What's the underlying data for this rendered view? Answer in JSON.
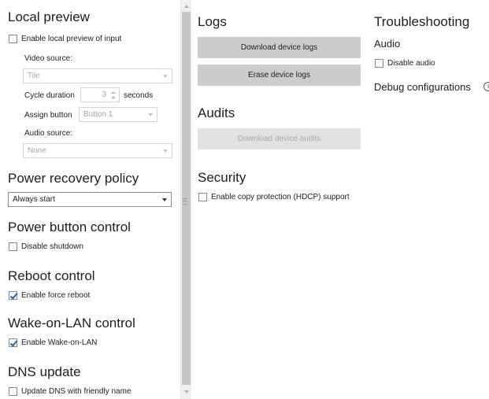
{
  "left": {
    "local_preview": {
      "title": "Local preview",
      "enable_label": "Enable local preview of input",
      "enable_checked": false,
      "video_source_label": "Video source:",
      "video_source_value": "Tile",
      "cycle_duration_label": "Cycle duration",
      "cycle_duration_value": "3",
      "cycle_duration_unit": "seconds",
      "assign_button_label": "Assign button",
      "assign_button_value": "Button 1",
      "audio_source_label": "Audio source:",
      "audio_source_value": "None"
    },
    "power_recovery": {
      "title": "Power recovery policy",
      "value": "Always start"
    },
    "power_button": {
      "title": "Power button control",
      "disable_shutdown_label": "Disable shutdown",
      "disable_shutdown_checked": false
    },
    "reboot": {
      "title": "Reboot control",
      "force_reboot_label": "Enable force reboot",
      "force_reboot_checked": true
    },
    "wol": {
      "title": "Wake-on-LAN control",
      "enable_label": "Enable Wake-on-LAN",
      "enable_checked": true
    },
    "dns": {
      "title": "DNS update",
      "update_label": "Update DNS with friendly name",
      "update_checked": false
    }
  },
  "middle": {
    "logs": {
      "title": "Logs",
      "download_label": "Download device logs",
      "erase_label": "Erase device logs"
    },
    "audits": {
      "title": "Audits",
      "download_label": "Download device audits"
    },
    "security": {
      "title": "Security",
      "hdcp_label": "Enable copy protection (HDCP) support",
      "hdcp_checked": false
    }
  },
  "right": {
    "title": "Troubleshooting",
    "audio_title": "Audio",
    "disable_audio_label": "Disable audio",
    "disable_audio_checked": false,
    "debug_title": "Debug configurations"
  },
  "icons": {
    "info": "info-icon",
    "scroll_up": "chevron-up-icon",
    "scroll_down": "chevron-down-icon",
    "dropdown": "chevron-down-icon",
    "check": "check-icon"
  },
  "colors": {
    "button": "#cccccc",
    "button_disabled": "#e2e2e2",
    "check": "#2a5caa"
  }
}
